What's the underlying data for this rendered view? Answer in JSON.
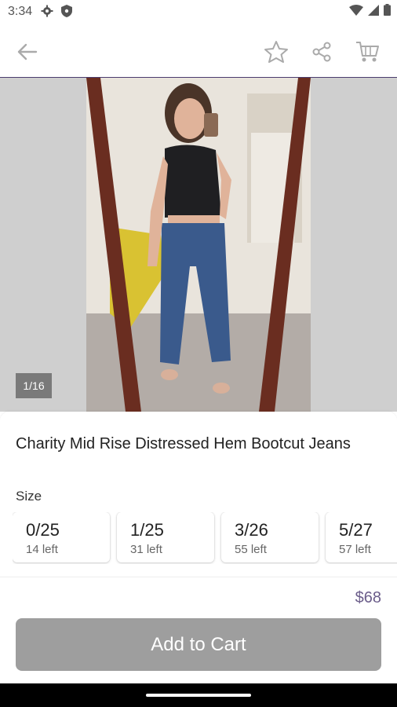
{
  "status_bar": {
    "time": "3:34"
  },
  "gallery": {
    "counter": "1/16"
  },
  "product": {
    "title": "Charity Mid Rise Distressed Hem Bootcut Jeans",
    "size_label": "Size",
    "sizes": [
      {
        "value": "0/25",
        "stock": "14 left"
      },
      {
        "value": "1/25",
        "stock": "31 left"
      },
      {
        "value": "3/26",
        "stock": "55 left"
      },
      {
        "value": "5/27",
        "stock": "57 left"
      }
    ],
    "price": "$68",
    "cta_label": "Add to Cart"
  },
  "colors": {
    "accent": "#6b5d8a",
    "cta_disabled": "#9e9e9e",
    "header_border": "#4b3c6e"
  }
}
